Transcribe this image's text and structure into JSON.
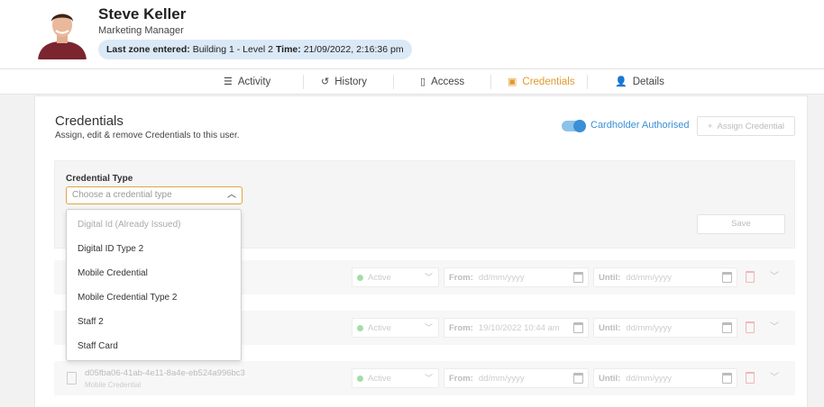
{
  "profile": {
    "name": "Steve Keller",
    "role": "Marketing Manager",
    "zone_label": "Last zone entered:",
    "zone_value": "Building 1 - Level 2",
    "time_label": "Time:",
    "time_value": "21/09/2022, 2:16:36 pm"
  },
  "tabs": [
    {
      "label": "Activity",
      "icon": "list-icon",
      "active": false
    },
    {
      "label": "History",
      "icon": "history-icon",
      "active": false
    },
    {
      "label": "Access",
      "icon": "door-icon",
      "active": false
    },
    {
      "label": "Credentials",
      "icon": "id-card-icon",
      "active": true
    },
    {
      "label": "Details",
      "icon": "person-icon",
      "active": false
    }
  ],
  "credentials": {
    "title": "Credentials",
    "subtitle": "Assign, edit & remove Credentials to this user.",
    "toggle_label": "Cardholder Authorised",
    "toggle_on": true,
    "assign_button": "Assign Credential",
    "form": {
      "type_label": "Credential Type",
      "type_placeholder": "Choose a credential type",
      "save_button": "Save"
    },
    "dropdown_options": [
      {
        "label": "Digital Id (Already Issued)",
        "disabled": true
      },
      {
        "label": "Digital ID Type 2",
        "disabled": false
      },
      {
        "label": "Mobile Credential",
        "disabled": false
      },
      {
        "label": "Mobile Credential Type 2",
        "disabled": false
      },
      {
        "label": "Staff 2",
        "disabled": false
      },
      {
        "label": "Staff Card",
        "disabled": false
      }
    ],
    "rows": [
      {
        "id": "",
        "type": "",
        "status": "Active",
        "from_label": "From:",
        "from_value": "dd/mm/yyyy",
        "until_label": "Until:",
        "until_value": "dd/mm/yyyy"
      },
      {
        "id": "",
        "type": "",
        "status": "Active",
        "from_label": "From:",
        "from_value": "19/10/2022 10:44 am",
        "until_label": "Until:",
        "until_value": "dd/mm/yyyy"
      },
      {
        "id": "d05fba06-41ab-4e11-8a4e-eb524a996bc3",
        "type": "Mobile Credential",
        "status": "Active",
        "from_label": "From:",
        "from_value": "dd/mm/yyyy",
        "until_label": "Until:",
        "until_value": "dd/mm/yyyy"
      }
    ]
  },
  "colors": {
    "accent": "#e09a2e",
    "primary": "#3a8fd6",
    "zone_pill": "#dbe9f7"
  }
}
